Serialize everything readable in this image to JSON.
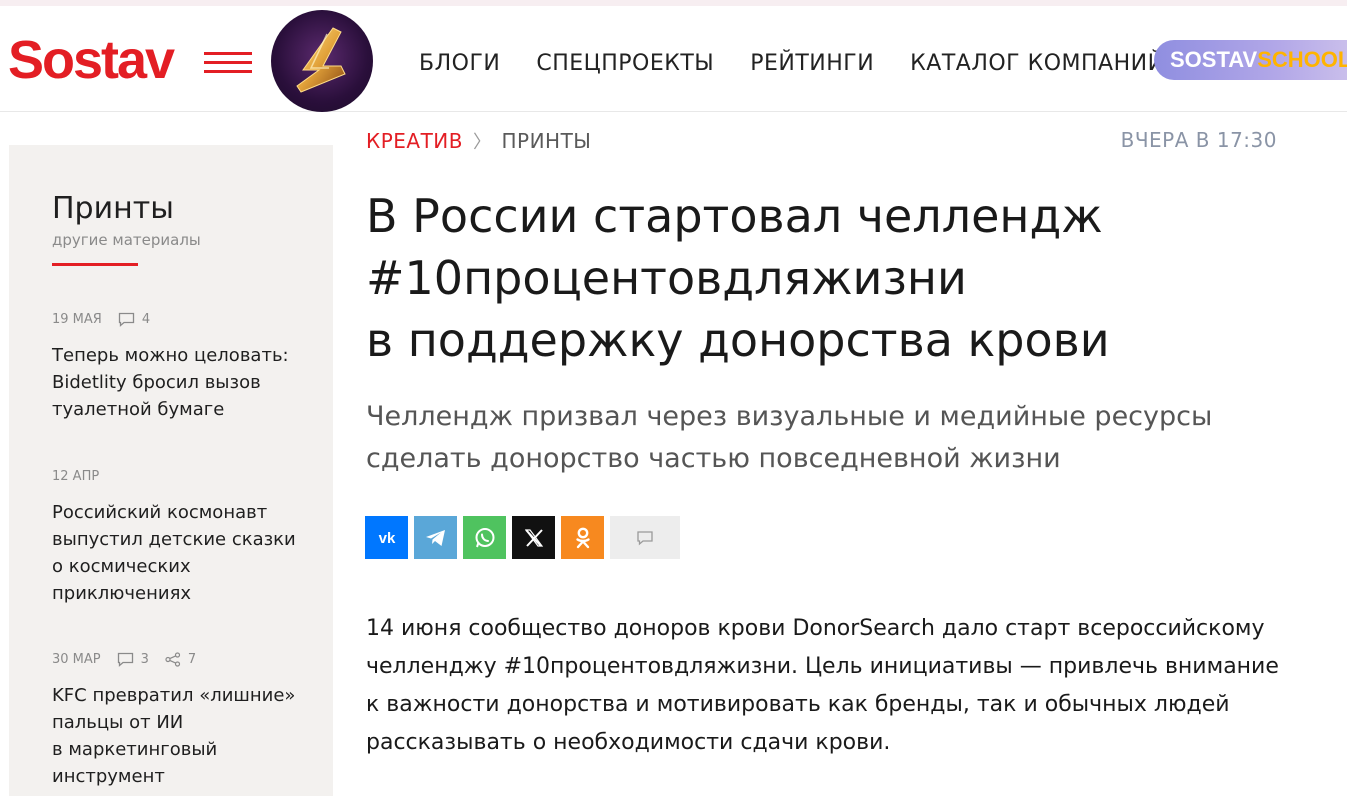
{
  "header": {
    "logo": "Sostav",
    "nav": [
      "БЛОГИ",
      "СПЕЦПРОЕКТЫ",
      "РЕЙТИНГИ",
      "КАТАЛОГ КОМПАНИЙ"
    ],
    "school_a": "SOSTAV",
    "school_b": "SCHOOL"
  },
  "sidebar": {
    "title": "Принты",
    "subtitle": "другие материалы",
    "items": [
      {
        "date": "19 МАЯ",
        "comments": "4",
        "shares": null,
        "lines": [
          "Теперь можно целовать:",
          "Bidetlity бросил вызов",
          "туалетной бумаге"
        ]
      },
      {
        "date": "12 АПР",
        "comments": null,
        "shares": null,
        "lines": [
          "Российский космонавт",
          "выпустил детские сказки",
          "о космических",
          "приключениях"
        ]
      },
      {
        "date": "30 МАР",
        "comments": "3",
        "shares": "7",
        "lines": [
          "KFC превратил «лишние»",
          "пальцы от ИИ",
          "в маркетинговый",
          "инструмент"
        ]
      }
    ]
  },
  "article": {
    "breadcrumb": {
      "section": "КРЕАТИВ",
      "separator": "〉",
      "subsection": "ПРИНТЫ"
    },
    "date": "ВЧЕРА В 17:30",
    "headline": [
      "В России стартовал челлендж",
      "#10процентовдляжизни",
      "в поддержку донорства крови"
    ],
    "lead": [
      "Челлендж призвал через визуальные и медийные ресурсы",
      "сделать донорство частью повседневной жизни"
    ],
    "body": [
      "14 июня сообщество доноров крови DonorSearch дало старт всероссийскому",
      "челленджу #10процентовдляжизни. Цель инициативы — привлечь внимание",
      "к важности донорства и мотивировать как бренды, так и обычных людей",
      "рассказывать о необходимости сдачи крови."
    ]
  },
  "share": {
    "icons": [
      "vk-icon",
      "telegram-icon",
      "whatsapp-icon",
      "x-icon",
      "odnoklassniki-icon",
      "comment-icon"
    ]
  },
  "colors": {
    "brand_red": "#e31e24",
    "vk": "#0077ff",
    "telegram": "#5aa7d8",
    "whatsapp": "#4fc35f",
    "x": "#111111",
    "ok": "#f7891f",
    "sidebar_bg": "#f3f1ef"
  }
}
